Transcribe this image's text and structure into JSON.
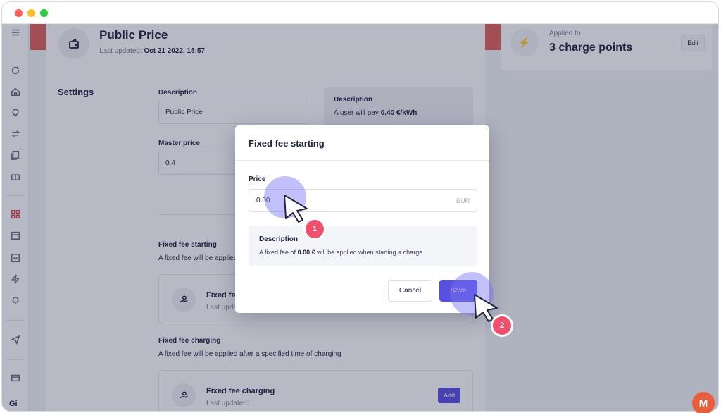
{
  "header": {
    "title": "Public Price",
    "last_updated_label": "Last updated:",
    "last_updated_value": "Oct 21 2022, 15:57"
  },
  "applied": {
    "label": "Applied to",
    "value": "3 charge points",
    "edit_label": "Edit"
  },
  "settings": {
    "section_label": "Settings",
    "description_label": "Description",
    "description_value": "Public Price",
    "master_price_label": "Master price",
    "master_price_value": "0.4",
    "desc_panel_title": "Description",
    "desc_panel_text_prefix": "A user will pay",
    "desc_panel_text_value": "0.40 €/kWh"
  },
  "fixed_fee_starting": {
    "title": "Fixed fee starting",
    "subtitle": "A fixed fee will be applied",
    "card_name": "Fixed fee",
    "card_updated": "Last upda"
  },
  "fixed_fee_charging": {
    "title": "Fixed fee charging",
    "subtitle": "A fixed fee will be applied after a specified time of charging",
    "card_name": "Fixed fee charging",
    "card_updated": "Last updated:",
    "add_label": "Add"
  },
  "modal": {
    "title": "Fixed fee starting",
    "price_label": "Price",
    "price_value": "0.00",
    "price_unit": "EUR",
    "desc_title": "Description",
    "desc_prefix": "A fixed fee of",
    "desc_value": "0.00 €",
    "desc_suffix": "will be applied when starting a charge",
    "cancel_label": "Cancel",
    "save_label": "Save"
  },
  "steps": {
    "step1": "1",
    "step2": "2"
  },
  "sidebar": {
    "bottom_label": "Gi"
  },
  "brand": {
    "logo_letter": "M"
  },
  "colors": {
    "accent": "#5a50e0",
    "step_badge": "#f0506e",
    "active_nav": "#e5484d",
    "logo": "#e85d3a"
  }
}
